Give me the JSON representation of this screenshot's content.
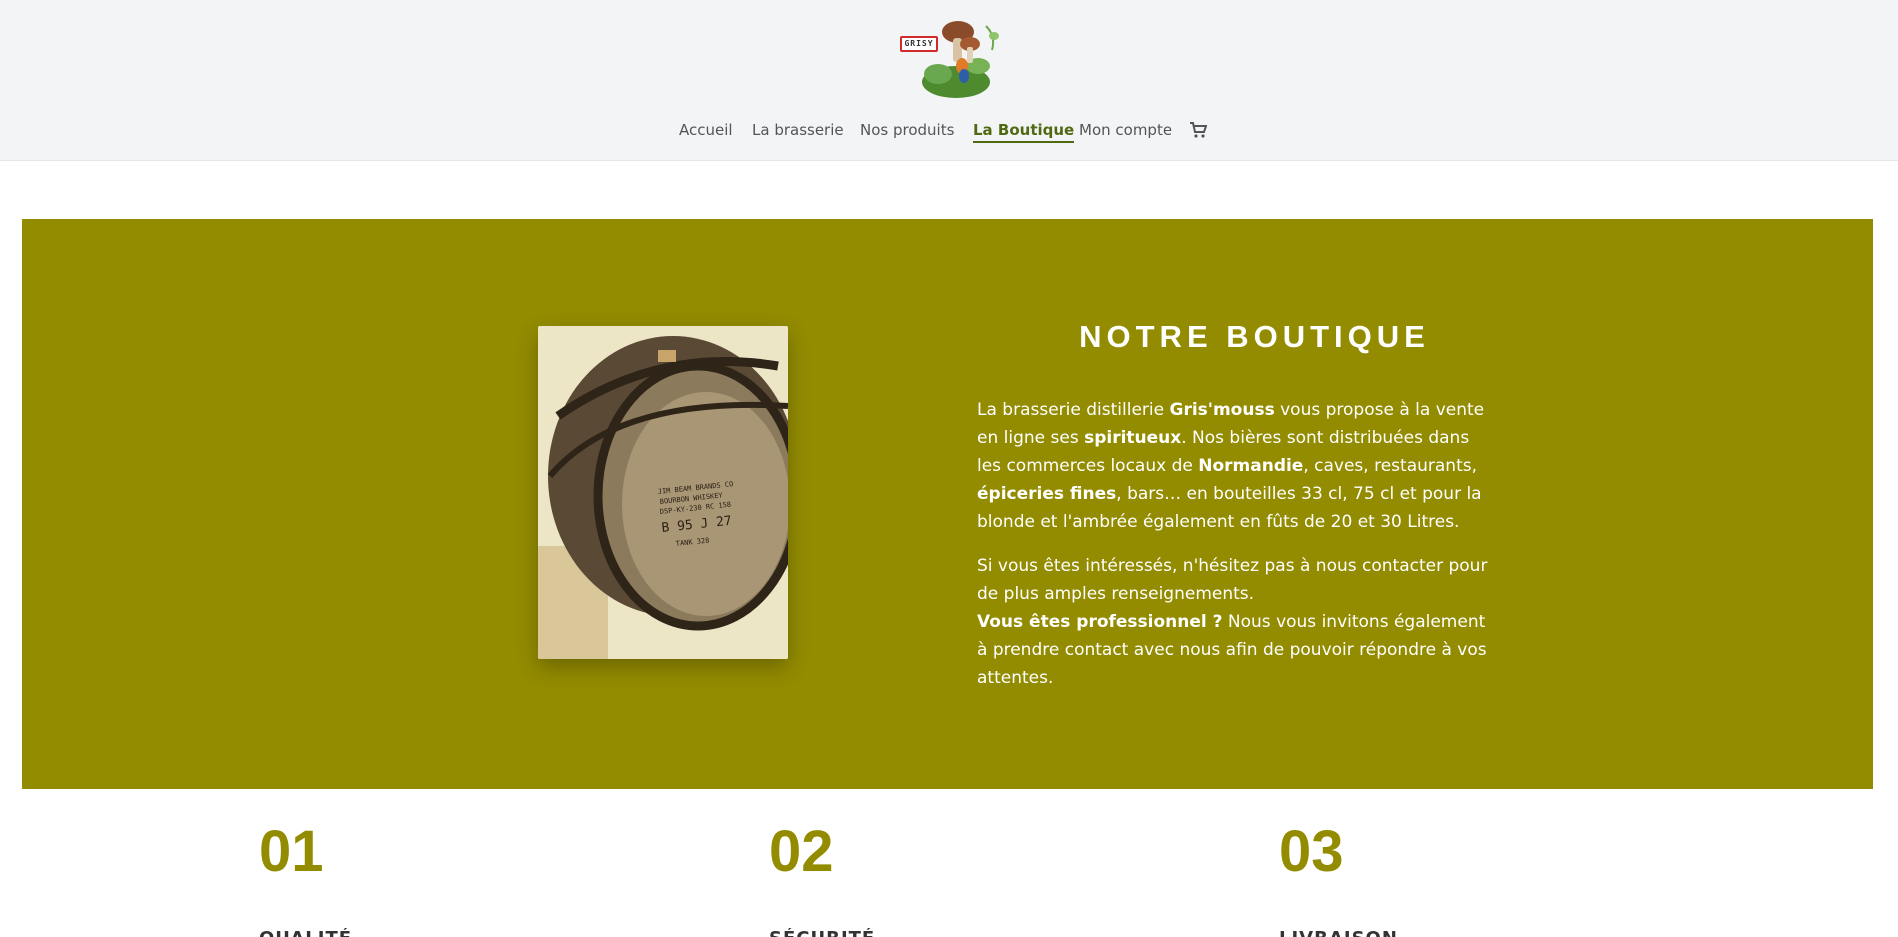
{
  "header": {
    "logo_text": "GRISY",
    "nav": [
      {
        "label": "Accueil",
        "active": false
      },
      {
        "label": "La brasserie",
        "active": false
      },
      {
        "label": "Nos produits",
        "active": false
      },
      {
        "label": "La Boutique",
        "active": true
      },
      {
        "label": "Mon compte",
        "active": false
      }
    ],
    "cart_icon": "cart-icon"
  },
  "hero": {
    "title": "NOTRE BOUTIQUE",
    "para1": {
      "t1": "La brasserie distillerie ",
      "b1": "Gris'mouss",
      "t2": " vous propose à la vente en ligne ses ",
      "b2": "spiritueux",
      "t3": ". Nos bières sont distribuées dans les commerces locaux de ",
      "b3": "Normandie",
      "t4": ", caves, restaurants, ",
      "b4": "épiceries fines",
      "t5": ", bars… en bouteilles 33 cl, 75 cl et pour la blonde et l'ambrée également en fûts de 20 et 30 Litres."
    },
    "para2": {
      "t1": "Si vous êtes intéressés, n'hésitez pas à nous contacter pour de plus amples renseignements.",
      "b1": "Vous êtes professionnel ?",
      "t2": " Nous vous invitons également à prendre contact avec nous afin de pouvoir répondre à vos attentes."
    },
    "bg_color": "#938c00"
  },
  "features": [
    {
      "number": "01",
      "label": "QUALITÉ"
    },
    {
      "number": "02",
      "label": "SÉCURITÉ"
    },
    {
      "number": "03",
      "label": "LIVRAISON"
    }
  ]
}
